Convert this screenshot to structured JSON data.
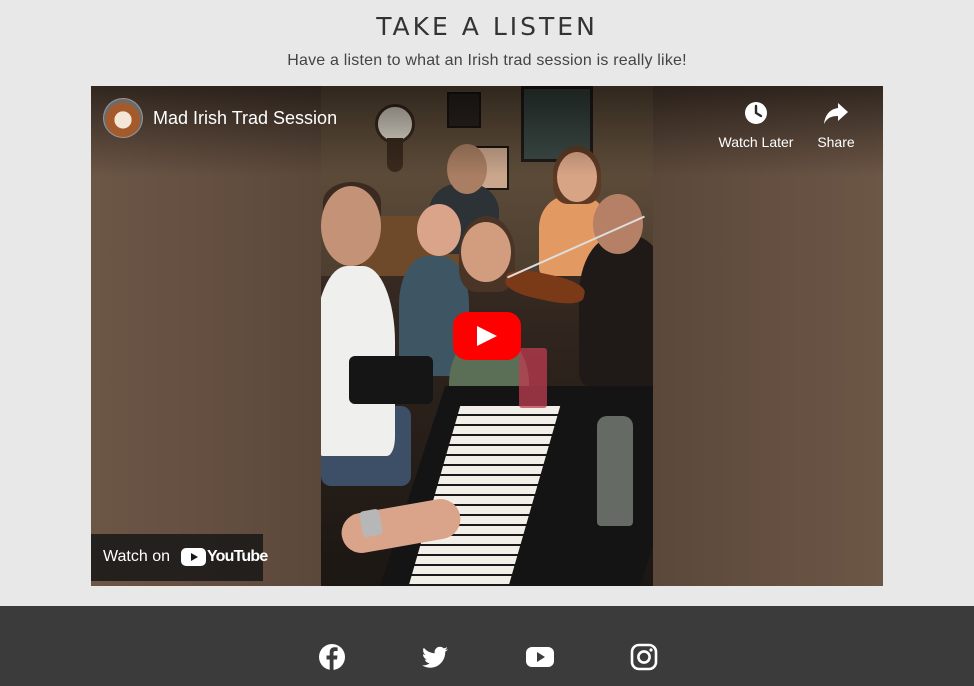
{
  "section": {
    "title": "TAKE A LISTEN",
    "subtitle": "Have a listen to what an Irish trad session is really like!"
  },
  "player": {
    "video_title": "Mad Irish Trad Session",
    "watch_later_label": "Watch Later",
    "share_label": "Share",
    "watch_on_label": "Watch on",
    "youtube_wordmark": "YouTube",
    "accent_color": "#ff0000"
  },
  "footer": {
    "social_icons": [
      "facebook-icon",
      "twitter-icon",
      "youtube-icon",
      "instagram-icon"
    ]
  }
}
